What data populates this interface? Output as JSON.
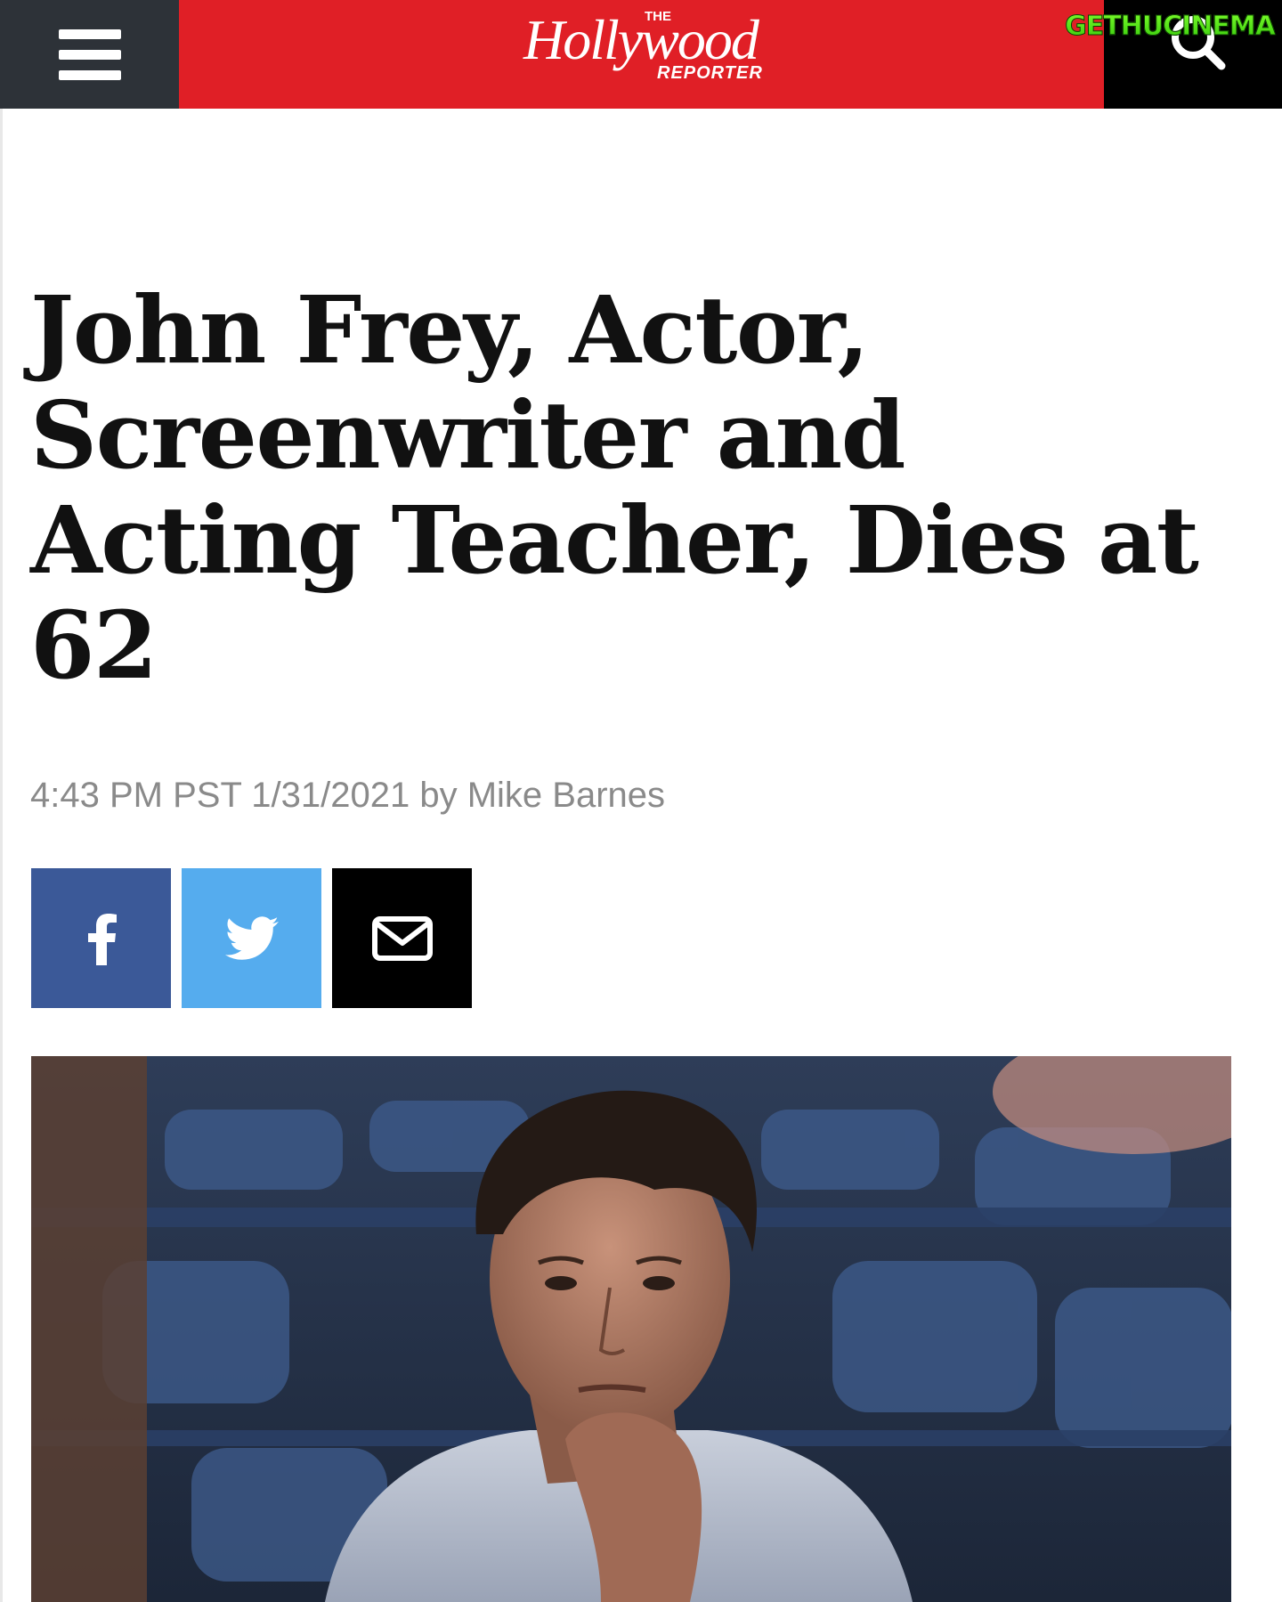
{
  "header": {
    "menu_icon": "hamburger-menu-icon",
    "logo": {
      "the": "THE",
      "name": "Hollywood",
      "reporter": "REPORTER"
    },
    "search_icon": "search-icon",
    "watermark": "GETHUCINEMA",
    "colors": {
      "brand_red": "#e01f26",
      "menu_bg": "#2d3238",
      "search_bg": "#000000"
    }
  },
  "article": {
    "headline": "John Frey, Actor, Screenwriter and Acting Teacher, Dies at 62",
    "timestamp": "4:43 PM PST 1/31/2021",
    "byline_prefix": "by",
    "author": "Mike Barnes"
  },
  "share": [
    {
      "network": "facebook",
      "icon": "facebook-icon",
      "color": "#3b5998"
    },
    {
      "network": "twitter",
      "icon": "twitter-bird-icon",
      "color": "#55acee"
    },
    {
      "network": "email",
      "icon": "envelope-icon",
      "color": "#000000"
    }
  ]
}
